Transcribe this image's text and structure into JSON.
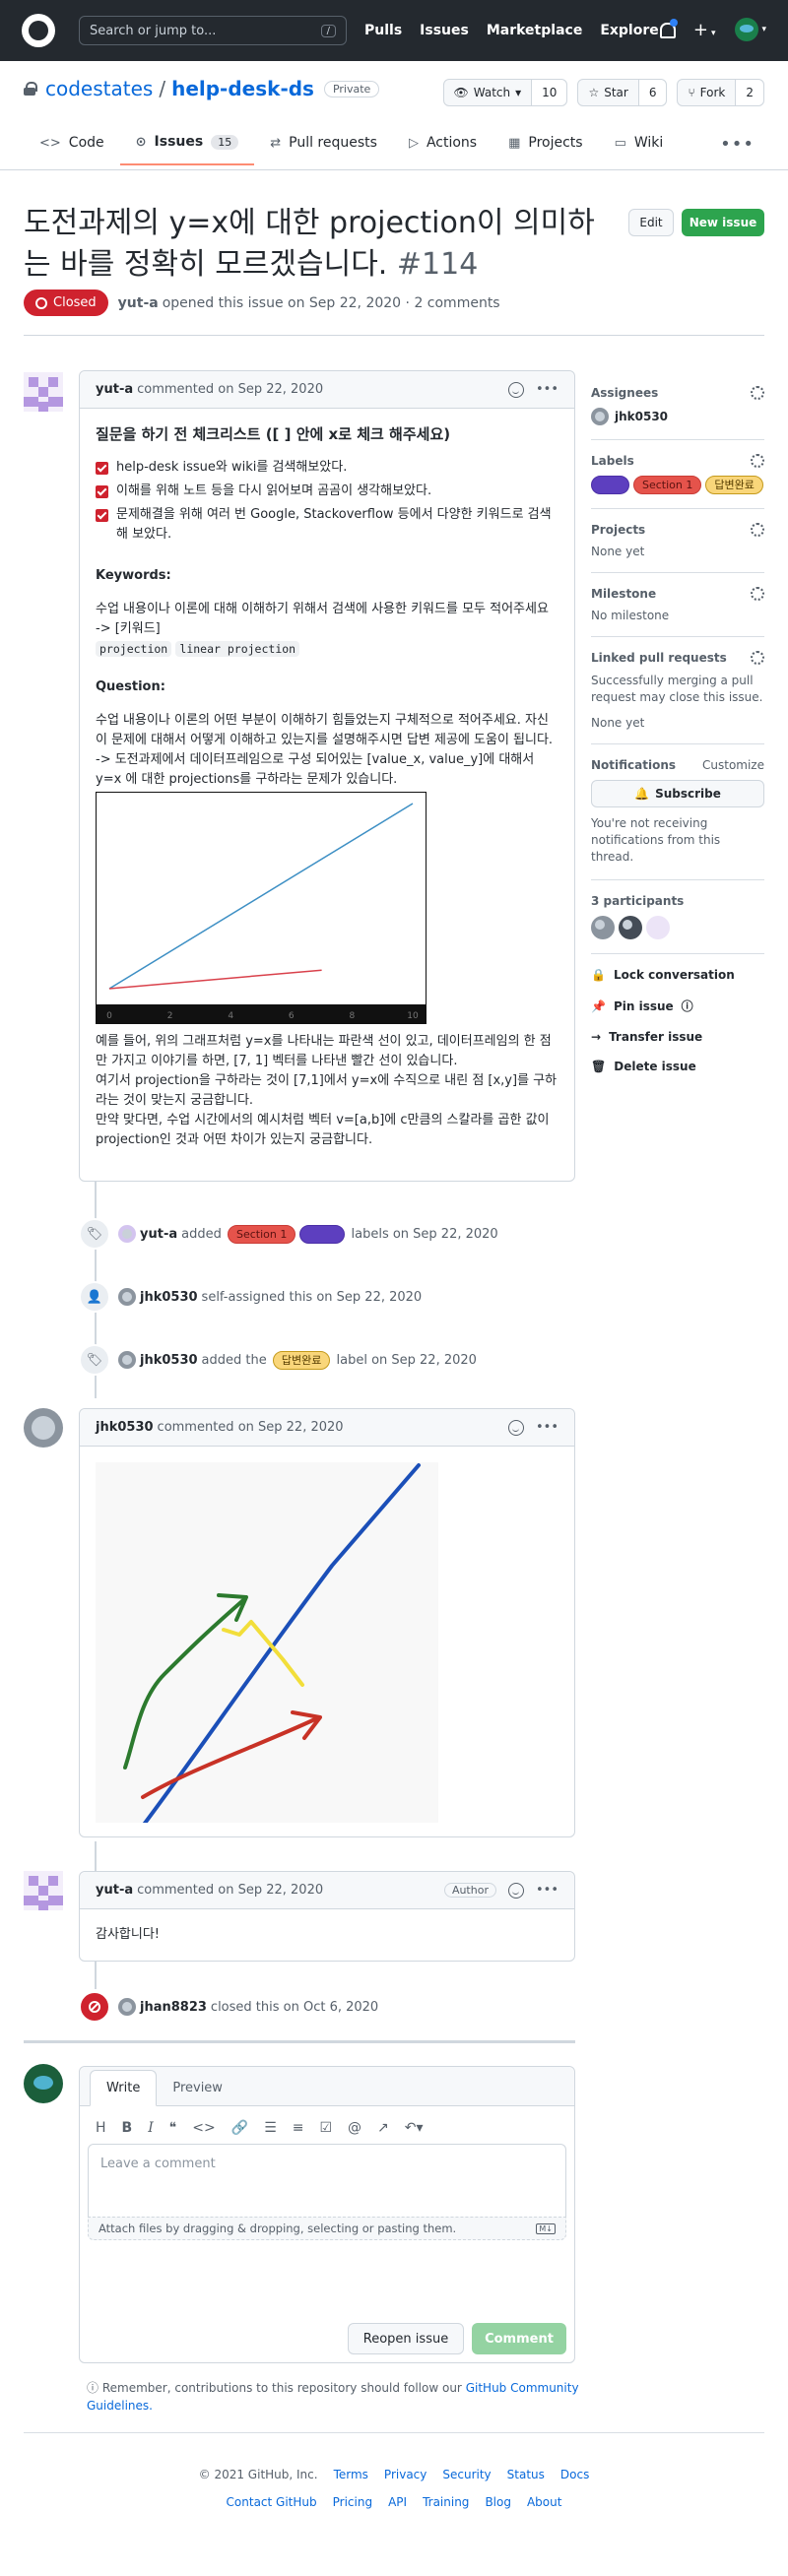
{
  "header": {
    "search_placeholder": "Search or jump to...",
    "search_key": "/",
    "nav": [
      "Pulls",
      "Issues",
      "Marketplace",
      "Explore"
    ],
    "plus": "+"
  },
  "repo": {
    "owner": "codestates",
    "separator": "/",
    "name": "help-desk-ds",
    "visibility": "Private",
    "watch_label": "Watch",
    "watch_count": "10",
    "star_label": "Star",
    "star_count": "6",
    "fork_label": "Fork",
    "fork_count": "2"
  },
  "tabs": [
    {
      "label": "Code"
    },
    {
      "label": "Issues",
      "count": "15"
    },
    {
      "label": "Pull requests"
    },
    {
      "label": "Actions"
    },
    {
      "label": "Projects"
    },
    {
      "label": "Wiki"
    }
  ],
  "issue": {
    "title": "도전과제의 y=x에 대한 projection이 의미하는 바를 정확히 모르겠습니다.",
    "number": "#114",
    "status": "Closed",
    "author": "yut-a",
    "meta": "opened this issue on Sep 22, 2020 · 2 comments",
    "edit_label": "Edit",
    "new_issue_label": "New issue"
  },
  "comment1": {
    "author": "yut-a",
    "date": "commented on Sep 22, 2020",
    "heading": "질문을 하기 전 체크리스트 ([ ] 안에 x로 체크 해주세요)",
    "checklist": [
      "help-desk issue와 wiki를 검색해보았다.",
      "이해를 위해 노트 등을 다시 읽어보며 곰곰이 생각해보았다.",
      "문제해결을 위해 여러 번 Google, Stackoverflow 등에서 다양한 키워드로 검색해 보았다."
    ],
    "keywords_title": "Keywords:",
    "keywords_desc": "수업 내용이나 이론에 대해 이해하기 위해서 검색에 사용한 키워드를 모두 적어주세요",
    "keywords_tag": "-> [키워드]",
    "codes": [
      "projection",
      "linear projection"
    ],
    "question_title": "Question:",
    "question_p1": "수업 내용이나 이론의 어떤 부분이 이해하기 힘들었는지 구체적으로 적어주세요. 자신이 문제에 대해서 어떻게 이해하고 있는지를 설명해주시면 답변 제공에 도움이 됩니다.",
    "question_p2": "-> 도전과제에서 데이터프레임으로 구성 되어있는 [value_x, value_y]에 대해서 y=x 에 대한 projections를 구하라는 문제가 있습니다.",
    "para2": "예를 들어, 위의 그래프처럼 y=x를 나타내는 파란색 선이 있고, 데이터프레임의 한 점만 가지고 이야기를 하면, [7, 1] 벡터를 나타낸 빨간 선이 있습니다.",
    "para3": "여기서 projection을 구하라는 것이 [7,1]에서 y=x에 수직으로 내린 점 [x,y]를 구하라는 것이 맞는지 궁금합니다.",
    "para4": "만약 맞다면, 수업 시간에서의 예시처럼 벡터 v=[a,b]에 c만큼의 스칼라를 곱한 값이 projection인 것과 어떤 차이가 있는지 궁금합니다."
  },
  "chart_data": {
    "type": "line",
    "ticks": [
      "0",
      "2",
      "4",
      "6",
      "8",
      "10"
    ],
    "series": [
      {
        "x": [
          0,
          10
        ],
        "y": [
          0,
          10
        ],
        "color": "#3d8fc4"
      },
      {
        "x": [
          0,
          7
        ],
        "y": [
          0,
          1
        ],
        "color": "#d9414b"
      }
    ],
    "xlim": [
      0,
      10
    ],
    "ylim": [
      0,
      10
    ]
  },
  "sidebar": {
    "assignees_title": "Assignees",
    "assignee": "jhk0530",
    "labels_title": "Labels",
    "labels": [
      "Section 1",
      "답변완료"
    ],
    "projects_title": "Projects",
    "projects_value": "None yet",
    "milestone_title": "Milestone",
    "milestone_value": "No milestone",
    "linked_title": "Linked pull requests",
    "linked_desc": "Successfully merging a pull request may close this issue.",
    "linked_value": "None yet",
    "notifications_title": "Notifications",
    "customize": "Customize",
    "subscribe": "Subscribe",
    "notif_desc": "You're not receiving notifications from this thread.",
    "participants_title": "3 participants",
    "lock": "Lock conversation",
    "pin": "Pin issue",
    "transfer": "Transfer issue",
    "delete": "Delete issue"
  },
  "events": {
    "ev1_user": "yut-a",
    "ev1_added": "added",
    "ev1_label1": "Section 1",
    "ev1_suffix": "labels on Sep 22, 2020",
    "ev2_user": "jhk0530",
    "ev2_text": "self-assigned this on Sep 22, 2020",
    "ev3_user": "jhk0530",
    "ev3_added": "added the",
    "ev3_label": "답변완료",
    "ev3_suffix": "label on Sep 22, 2020",
    "ev4_user": "jhan8823",
    "ev4_text": "closed this on Oct 6, 2020"
  },
  "comment2": {
    "author": "jhk0530",
    "date": "commented on Sep 22, 2020"
  },
  "comment3": {
    "author": "yut-a",
    "date": "commented on Sep 22, 2020",
    "badge": "Author",
    "body": "감사합니다!"
  },
  "editor": {
    "write": "Write",
    "preview": "Preview",
    "placeholder": "Leave a comment",
    "attach": "Attach files by dragging & dropping, selecting or pasting them.",
    "reopen": "Reopen issue",
    "comment": "Comment",
    "guideline_prefix": "Remember, contributions to this repository should follow our",
    "guideline_link": "GitHub Community Guidelines."
  },
  "footer": {
    "copyright": "© 2021 GitHub, Inc.",
    "row1": [
      "Terms",
      "Privacy",
      "Security",
      "Status",
      "Docs"
    ],
    "row2": [
      "Contact GitHub",
      "Pricing",
      "API",
      "Training",
      "Blog",
      "About"
    ]
  }
}
